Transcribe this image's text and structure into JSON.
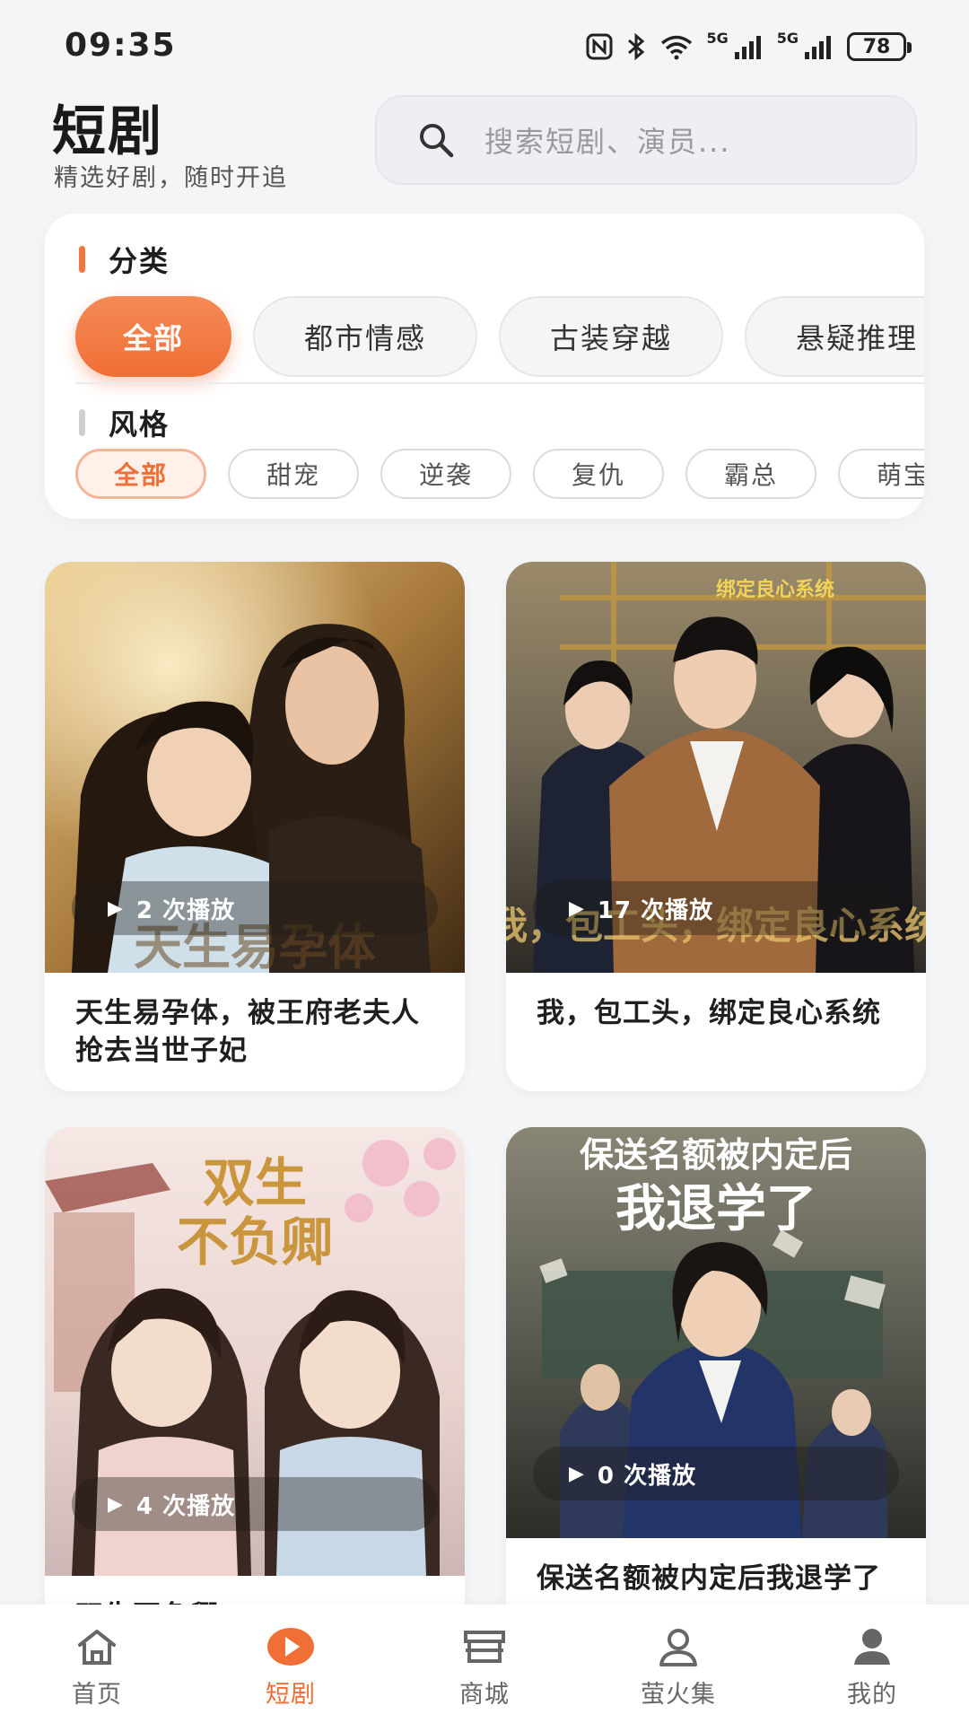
{
  "status": {
    "time": "09:35",
    "network_label": "5G",
    "battery": "78"
  },
  "header": {
    "title": "短剧",
    "subtitle": "精选好剧，随时开追"
  },
  "search": {
    "placeholder": "搜索短剧、演员..."
  },
  "filters": {
    "category_title": "分类",
    "categories": [
      "全部",
      "都市情感",
      "古装穿越",
      "悬疑推理"
    ],
    "style_title": "风格",
    "styles": [
      "全部",
      "甜宠",
      "逆袭",
      "复仇",
      "霸总",
      "萌宝"
    ]
  },
  "cards": [
    {
      "title": "天生易孕体，被王府老夫人抢去当世子妃",
      "plays": "2 次播放",
      "poster_text": "天生易孕体"
    },
    {
      "title": "我，包工头，绑定良心系统",
      "plays": "17 次播放",
      "poster_text": "我，包工头，绑定良心系统",
      "poster_top": "绑定良心系统"
    },
    {
      "title": "双生不负卿",
      "plays": "4 次播放",
      "poster_text_1": "双生",
      "poster_text_2": "不负卿"
    },
    {
      "title": "保送名额被内定后我退学了",
      "plays": "0 次播放",
      "poster_text_1": "保送名额被内定后",
      "poster_text_2": "我退学了"
    }
  ],
  "tabbar": {
    "tabs": [
      "首页",
      "短剧",
      "商城",
      "萤火集",
      "我的"
    ],
    "active": "短剧"
  },
  "colors": {
    "accent": "#ef6f36",
    "background": "#f4f5f7"
  }
}
